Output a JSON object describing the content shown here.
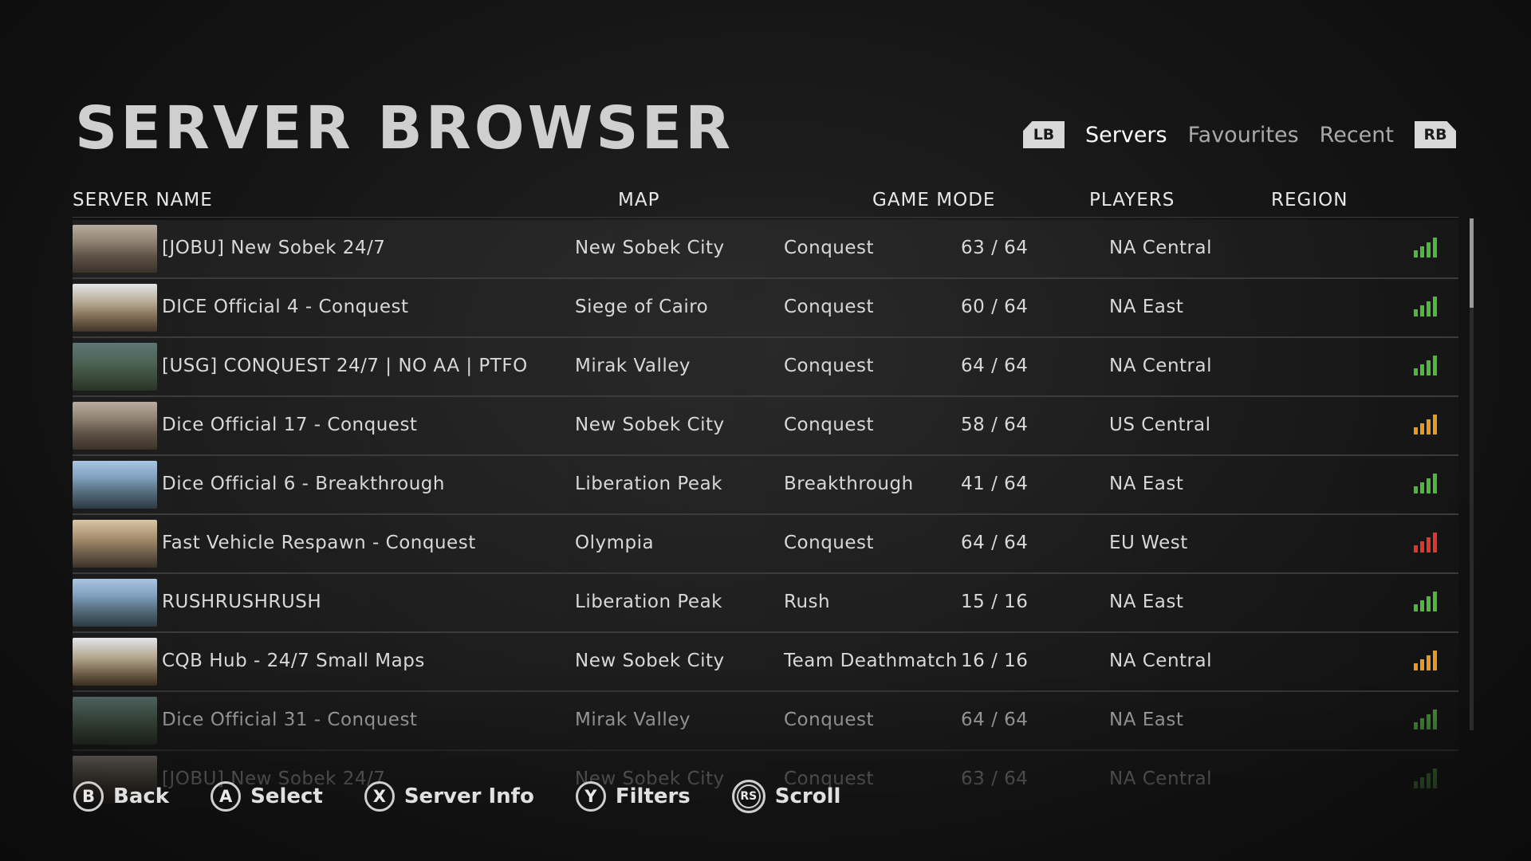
{
  "page_title": "SERVER BROWSER",
  "tabs": {
    "lb_label": "LB",
    "rb_label": "RB",
    "items": [
      "Servers",
      "Favourites",
      "Recent"
    ],
    "active": "Servers"
  },
  "columns": {
    "server_name": "SERVER NAME",
    "map": "MAP",
    "game_mode": "GAME MODE",
    "players": "PLAYERS",
    "region": "REGION"
  },
  "signal_colors": {
    "good": "#4fb83a",
    "medium": "#e89a1e",
    "poor": "#e0362c"
  },
  "servers": [
    {
      "thumb": "city",
      "name": "[JOBU] New Sobek 24/7",
      "map": "New Sobek City",
      "mode": "Conquest",
      "players": "63 / 64",
      "region": "NA Central",
      "signal": "good"
    },
    {
      "thumb": "cairo",
      "name": "DICE Official 4 - Conquest",
      "map": "Siege of Cairo",
      "mode": "Conquest",
      "players": "60 / 64",
      "region": "NA East",
      "signal": "good"
    },
    {
      "thumb": "valley",
      "name": "[USG] CONQUEST 24/7 | NO AA  | PTFO",
      "map": "Mirak Valley",
      "mode": "Conquest",
      "players": "64 / 64",
      "region": "NA Central",
      "signal": "good"
    },
    {
      "thumb": "city",
      "name": "Dice Official 17 - Conquest",
      "map": "New Sobek City",
      "mode": "Conquest",
      "players": "58 / 64",
      "region": "US Central",
      "signal": "medium"
    },
    {
      "thumb": "peak",
      "name": "Dice Official 6 - Breakthrough",
      "map": "Liberation Peak",
      "mode": "Breakthrough",
      "players": "41 / 64",
      "region": "NA East",
      "signal": "good"
    },
    {
      "thumb": "olympia",
      "name": "Fast Vehicle Respawn - Conquest",
      "map": "Olympia",
      "mode": "Conquest",
      "players": "64 / 64",
      "region": "EU West",
      "signal": "poor"
    },
    {
      "thumb": "peak",
      "name": "RUSHRUSHRUSH",
      "map": "Liberation Peak",
      "mode": "Rush",
      "players": "15 / 16",
      "region": "NA East",
      "signal": "good"
    },
    {
      "thumb": "cairo",
      "name": "CQB Hub - 24/7 Small Maps",
      "map": "New Sobek City",
      "mode": "Team Deathmatch",
      "players": "16 / 16",
      "region": "NA Central",
      "signal": "medium"
    },
    {
      "thumb": "valley",
      "name": "Dice Official 31 - Conquest",
      "map": "Mirak Valley",
      "mode": "Conquest",
      "players": "64 / 64",
      "region": "NA East",
      "signal": "good"
    },
    {
      "thumb": "city",
      "name": "[JOBU] New Sobek 24/7",
      "map": "New Sobek City",
      "mode": "Conquest",
      "players": "63 / 64",
      "region": "NA Central",
      "signal": "good"
    }
  ],
  "footer": {
    "back": {
      "button": "B",
      "label": "Back"
    },
    "select": {
      "button": "A",
      "label": "Select"
    },
    "info": {
      "button": "X",
      "label": "Server Info"
    },
    "filters": {
      "button": "Y",
      "label": "Filters"
    },
    "scroll": {
      "button": "RS",
      "label": "Scroll"
    }
  }
}
